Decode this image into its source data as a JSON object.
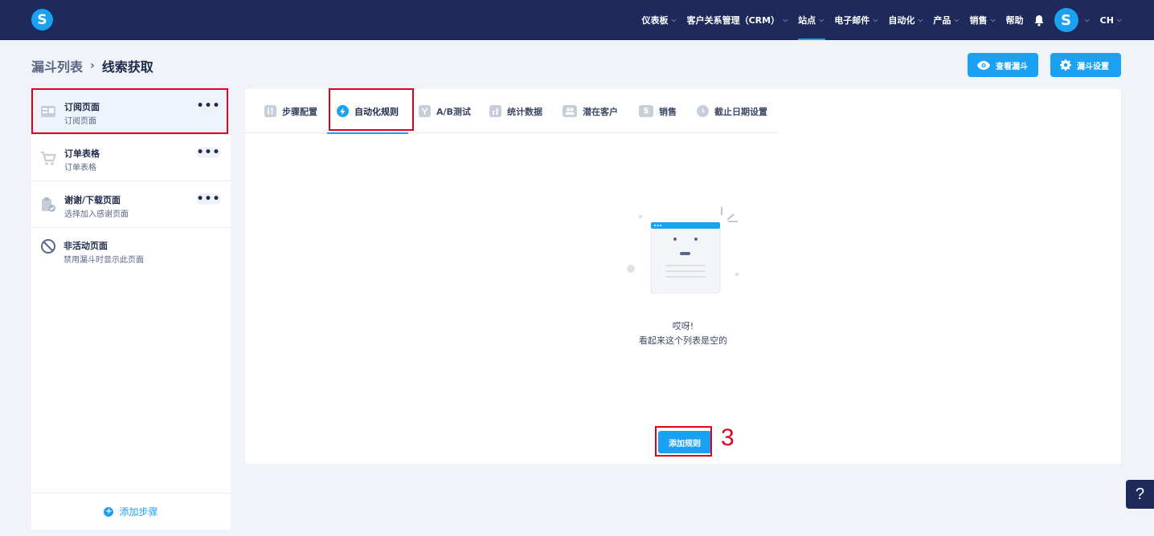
{
  "brand": {
    "logo_letter": "S",
    "accent": "#1ba1f2",
    "nav_bg": "#1d2a5b"
  },
  "nav": {
    "items": [
      {
        "label": "仪表板",
        "dropdown": true
      },
      {
        "label": "客户关系管理（CRM）",
        "dropdown": true
      },
      {
        "label": "站点",
        "dropdown": true,
        "active": true
      },
      {
        "label": "电子邮件",
        "dropdown": true
      },
      {
        "label": "自动化",
        "dropdown": true
      },
      {
        "label": "产品",
        "dropdown": true
      },
      {
        "label": "销售",
        "dropdown": true
      },
      {
        "label": "帮助",
        "dropdown": false
      }
    ],
    "avatar_letter": "S",
    "language": "CH",
    "chevron": "⌵",
    "icons": [
      "bell-icon",
      "chevron-down-icon"
    ]
  },
  "breadcrumb": {
    "parent": "漏斗列表",
    "separator": "›",
    "current": "线索获取"
  },
  "actions": {
    "view_funnel": "查看漏斗",
    "funnel_settings": "漏斗设置"
  },
  "steps": [
    {
      "title": "订阅页面",
      "subtitle": "订阅页面",
      "icon": "page-icon",
      "menu": "•••"
    },
    {
      "title": "订单表格",
      "subtitle": "订单表格",
      "icon": "cart-icon",
      "menu": "•••"
    },
    {
      "title": "谢谢/下载页面",
      "subtitle": "选择加入感谢页面",
      "icon": "clipboard-check-icon",
      "menu": "•••"
    },
    {
      "title": "非活动页面",
      "subtitle": "禁用漏斗时显示此页面",
      "icon": "ban-icon"
    }
  ],
  "add_step": {
    "plus": "+",
    "label": "添加步骤"
  },
  "tabs": [
    {
      "label": "步骤配置",
      "icon": "sliders-icon"
    },
    {
      "label": "自动化规则",
      "icon": "lightning-icon",
      "active": true
    },
    {
      "label": "A/B测试",
      "icon": "split-icon"
    },
    {
      "label": "统计数据",
      "icon": "bar-chart-icon"
    },
    {
      "label": "潜在客户",
      "icon": "users-icon"
    },
    {
      "label": "销售",
      "icon": "dollar-icon"
    },
    {
      "label": "截止日期设置",
      "icon": "clock-icon"
    }
  ],
  "empty": {
    "line1": "哎呀!",
    "line2": "看起来这个列表是空的"
  },
  "add_rule": "添加规则",
  "annotation": "3",
  "help": "?"
}
